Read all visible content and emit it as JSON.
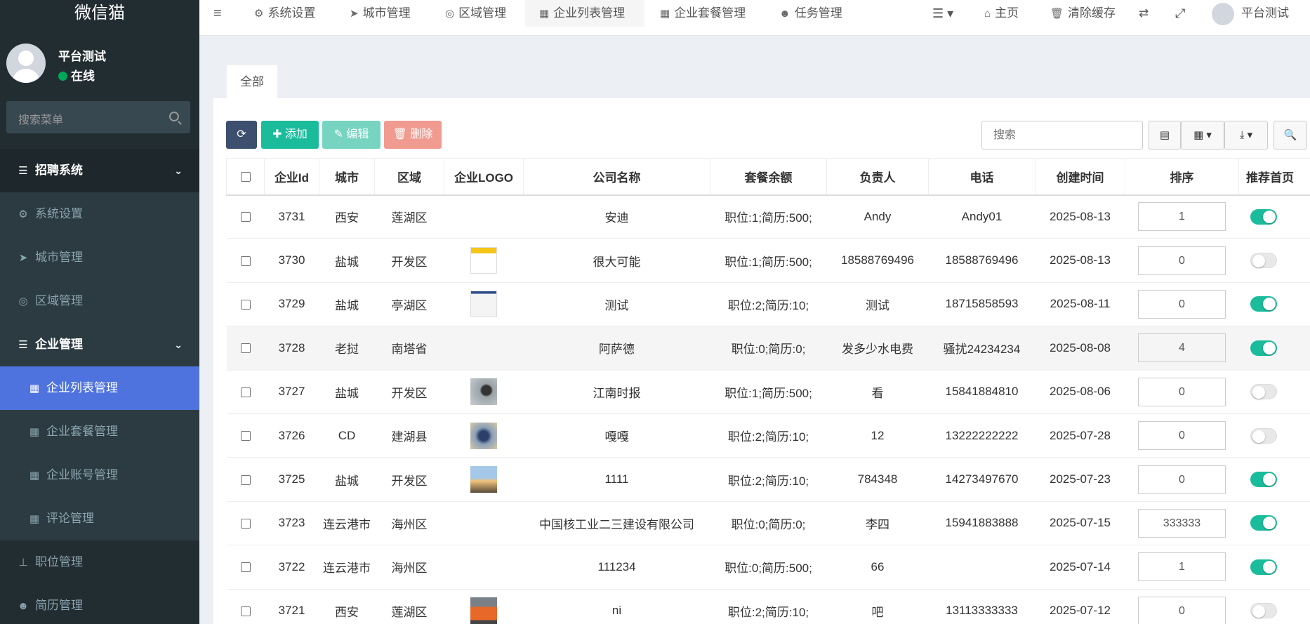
{
  "brand": "微信猫",
  "user": {
    "name": "平台测试",
    "status": "在线"
  },
  "sidebar_search_placeholder": "搜索菜单",
  "menu": {
    "recruit": "招聘系统",
    "system": "系统设置",
    "city": "城市管理",
    "area": "区域管理",
    "company": "企业管理",
    "company_list": "企业列表管理",
    "company_package": "企业套餐管理",
    "company_account": "企业账号管理",
    "comments": "评论管理",
    "jobs": "职位管理",
    "resumes": "简历管理"
  },
  "topnav": {
    "system": "系统设置",
    "city": "城市管理",
    "area": "区域管理",
    "company_list": "企业列表管理",
    "company_package": "企业套餐管理",
    "tasks": "任务管理",
    "home": "主页",
    "clear_cache": "清除缓存",
    "user": "平台测试"
  },
  "tab_all": "全部",
  "toolbar": {
    "add": "添加",
    "edit": "编辑",
    "delete": "删除",
    "search_placeholder": "搜索"
  },
  "columns": [
    "企业Id",
    "城市",
    "区域",
    "企业LOGO",
    "公司名称",
    "套餐余额",
    "负责人",
    "电话",
    "创建时间",
    "排序",
    "推荐首页"
  ],
  "rows": [
    {
      "id": "3731",
      "city": "西安",
      "area": "莲湖区",
      "logo": "",
      "name": "安迪",
      "balance": "职位:1;简历:500;",
      "owner": "Andy",
      "phone": "Andy01",
      "date": "2025-08-13",
      "sort": "1",
      "recommend": true
    },
    {
      "id": "3730",
      "city": "盐城",
      "area": "开发区",
      "logo": "doc-yellow",
      "name": "很大可能",
      "balance": "职位:1;简历:500;",
      "owner": "18588769496",
      "phone": "18588769496",
      "date": "2025-08-13",
      "sort": "0",
      "recommend": false
    },
    {
      "id": "3729",
      "city": "盐城",
      "area": "亭湖区",
      "logo": "doc-blue",
      "name": "测试",
      "balance": "职位:2;简历:10;",
      "owner": "测试",
      "phone": "18715858593",
      "date": "2025-08-11",
      "sort": "0",
      "recommend": true
    },
    {
      "id": "3728",
      "city": "老挝",
      "area": "南塔省",
      "logo": "",
      "name": "阿萨德",
      "balance": "职位:0;简历:0;",
      "owner": "发多少水电费",
      "phone": "骚扰24234234",
      "date": "2025-08-08",
      "sort": "4",
      "recommend": true
    },
    {
      "id": "3727",
      "city": "盐城",
      "area": "开发区",
      "logo": "photo-grey",
      "name": "江南时报",
      "balance": "职位:1;简历:500;",
      "owner": "看",
      "phone": "15841884810",
      "date": "2025-08-06",
      "sort": "0",
      "recommend": false
    },
    {
      "id": "3726",
      "city": "CD",
      "area": "建湖县",
      "logo": "photo-blue",
      "name": "嘎嘎",
      "balance": "职位:2;简历:10;",
      "owner": "12",
      "phone": "13222222222",
      "date": "2025-07-28",
      "sort": "0",
      "recommend": false
    },
    {
      "id": "3725",
      "city": "盐城",
      "area": "开发区",
      "logo": "photo-sunset",
      "name": "1111",
      "balance": "职位:2;简历:10;",
      "owner": "784348",
      "phone": "14273497670",
      "date": "2025-07-23",
      "sort": "0",
      "recommend": true
    },
    {
      "id": "3723",
      "city": "连云港市",
      "area": "海州区",
      "logo": "",
      "name": "中国核工业二三建设有限公司",
      "balance": "职位:0;简历:0;",
      "owner": "李四",
      "phone": "15941883888",
      "date": "2025-07-15",
      "sort": "333333",
      "recommend": true
    },
    {
      "id": "3722",
      "city": "连云港市",
      "area": "海州区",
      "logo": "",
      "name": "111234",
      "balance": "职位:0;简历:500;",
      "owner": "66",
      "phone": "",
      "date": "2025-07-14",
      "sort": "1",
      "recommend": true
    },
    {
      "id": "3721",
      "city": "西安",
      "area": "莲湖区",
      "logo": "photo-orange",
      "name": "ni",
      "balance": "职位:2;简历:10;",
      "owner": "吧",
      "phone": "13113333333",
      "date": "2025-07-12",
      "sort": "0",
      "recommend": false
    }
  ],
  "colors": {
    "sidebar": "#222d32",
    "active": "#4e73df",
    "teal": "#1abc9c",
    "online": "#00a65a"
  }
}
